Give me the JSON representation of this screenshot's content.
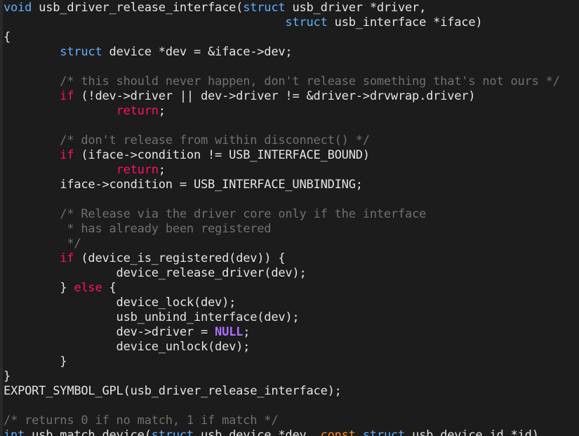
{
  "lines": [
    [
      {
        "t": "void",
        "c": "kw-type"
      },
      {
        "t": " usb_driver_release_interface("
      },
      {
        "t": "struct",
        "c": "kw-type"
      },
      {
        "t": " usb_driver *driver,"
      }
    ],
    [
      {
        "t": "                                        "
      },
      {
        "t": "struct",
        "c": "kw-type"
      },
      {
        "t": " usb_interface *iface)"
      }
    ],
    [
      {
        "t": "{"
      }
    ],
    [
      {
        "t": "        "
      },
      {
        "t": "struct",
        "c": "kw-type"
      },
      {
        "t": " device *dev = &iface->dev;"
      }
    ],
    [
      {
        "t": ""
      }
    ],
    [
      {
        "t": "        "
      },
      {
        "t": "/* this should never happen, don't release something that's not ours */",
        "c": "comment"
      }
    ],
    [
      {
        "t": "        "
      },
      {
        "t": "if",
        "c": "kw-ctrl"
      },
      {
        "t": " (!dev->driver || dev->driver != &driver->drvwrap.driver)"
      }
    ],
    [
      {
        "t": "                "
      },
      {
        "t": "return",
        "c": "kw-ctrl"
      },
      {
        "t": ";"
      }
    ],
    [
      {
        "t": ""
      }
    ],
    [
      {
        "t": "        "
      },
      {
        "t": "/* don't release from within disconnect() */",
        "c": "comment"
      }
    ],
    [
      {
        "t": "        "
      },
      {
        "t": "if",
        "c": "kw-ctrl"
      },
      {
        "t": " (iface->condition != USB_INTERFACE_BOUND)"
      }
    ],
    [
      {
        "t": "                "
      },
      {
        "t": "return",
        "c": "kw-ctrl"
      },
      {
        "t": ";"
      }
    ],
    [
      {
        "t": "        iface->condition = USB_INTERFACE_UNBINDING;"
      }
    ],
    [
      {
        "t": ""
      }
    ],
    [
      {
        "t": "        "
      },
      {
        "t": "/* Release via the driver core only if the interface",
        "c": "comment"
      }
    ],
    [
      {
        "t": "         "
      },
      {
        "t": "* has already been registered",
        "c": "comment"
      }
    ],
    [
      {
        "t": "         "
      },
      {
        "t": "*/",
        "c": "comment"
      }
    ],
    [
      {
        "t": "        "
      },
      {
        "t": "if",
        "c": "kw-ctrl"
      },
      {
        "t": " (device_is_registered(dev)) {"
      }
    ],
    [
      {
        "t": "                device_release_driver(dev);"
      }
    ],
    [
      {
        "t": "        } "
      },
      {
        "t": "else",
        "c": "kw-ctrl"
      },
      {
        "t": " {"
      }
    ],
    [
      {
        "t": "                device_lock(dev);"
      }
    ],
    [
      {
        "t": "                usb_unbind_interface(dev);"
      }
    ],
    [
      {
        "t": "                dev->driver = "
      },
      {
        "t": "NULL",
        "c": "kw-null"
      },
      {
        "t": ";"
      }
    ],
    [
      {
        "t": "                device_unlock(dev);"
      }
    ],
    [
      {
        "t": "        }"
      }
    ],
    [
      {
        "t": "}"
      }
    ],
    [
      {
        "t": "EXPORT_SYMBOL_GPL(usb_driver_release_interface);"
      }
    ],
    [
      {
        "t": ""
      }
    ],
    [
      {
        "t": "/* returns 0 if no match, 1 if match */",
        "c": "comment"
      }
    ],
    [
      {
        "t": "int",
        "c": "kw-type"
      },
      {
        "t": " usb_match_device("
      },
      {
        "t": "struct",
        "c": "kw-type"
      },
      {
        "t": " usb_device *dev, "
      },
      {
        "t": "const",
        "c": "kw-const"
      },
      {
        "t": " "
      },
      {
        "t": "struct",
        "c": "kw-type"
      },
      {
        "t": " usb_device_id *id)"
      }
    ]
  ]
}
